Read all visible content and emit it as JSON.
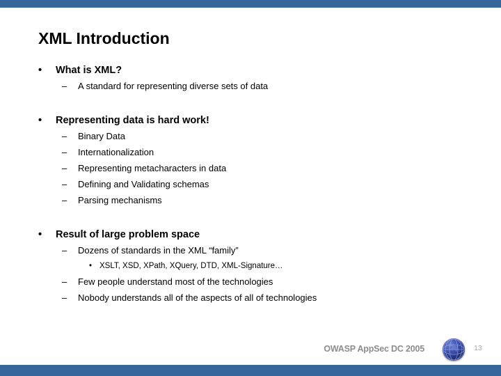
{
  "theme": {
    "bar_color": "#36679a",
    "background": "#ffffff",
    "text_color": "#000000",
    "footer_text_color": "#8d8d8d",
    "page_number_color": "#a6a6a6"
  },
  "slide": {
    "title": "XML Introduction",
    "groups": [
      {
        "heading": "What is XML?",
        "marker": "•",
        "children": [
          {
            "level": 2,
            "marker": "–",
            "text": "A standard for representing diverse sets of data"
          }
        ]
      },
      {
        "heading": "Representing data is hard work!",
        "marker": "•",
        "children": [
          {
            "level": 2,
            "marker": "–",
            "text": "Binary Data"
          },
          {
            "level": 2,
            "marker": "–",
            "text": "Internationalization"
          },
          {
            "level": 2,
            "marker": "–",
            "text": "Representing metacharacters in data"
          },
          {
            "level": 2,
            "marker": "–",
            "text": "Defining and Validating schemas"
          },
          {
            "level": 2,
            "marker": "–",
            "text": "Parsing mechanisms"
          }
        ]
      },
      {
        "heading": "Result of large problem space",
        "marker": "•",
        "children": [
          {
            "level": 2,
            "marker": "–",
            "text": "Dozens of standards in the XML “family”"
          },
          {
            "level": 3,
            "marker": "•",
            "text": "XSLT, XSD, XPath, XQuery, DTD, XML-Signature…"
          },
          {
            "level": 2,
            "marker": "–",
            "text": "Few people understand most of the technologies"
          },
          {
            "level": 2,
            "marker": "–",
            "text": "Nobody understands all of the aspects of all of technologies"
          }
        ]
      }
    ]
  },
  "footer": {
    "conference": "OWASP AppSec DC 2005",
    "logo_name": "owasp-globe-icon",
    "page_number": "13"
  }
}
